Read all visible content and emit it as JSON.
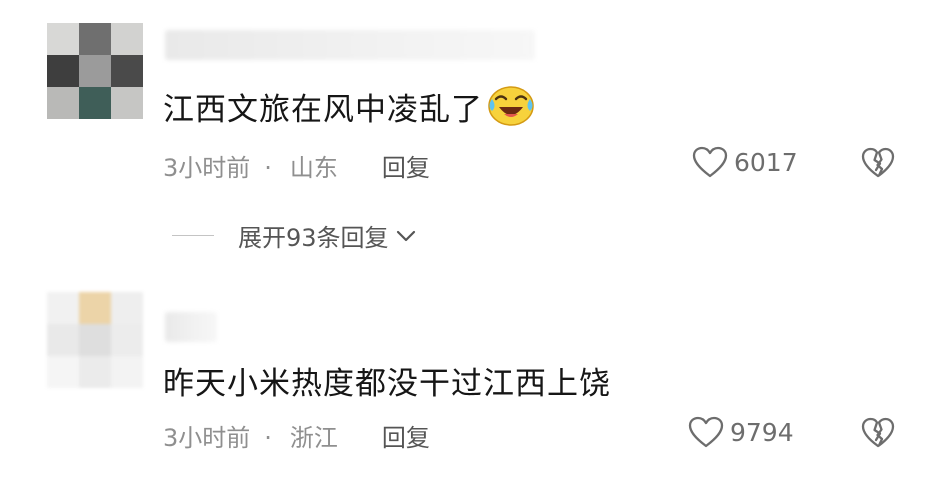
{
  "comments": [
    {
      "text": "江西文旅在风中凌乱了",
      "emoji": "laughing-crying-emoji",
      "time": "3小时前",
      "separator": "·",
      "location": "山东",
      "reply_label": "回复",
      "likes": "6017",
      "expand_label": "展开93条回复"
    },
    {
      "text": "昨天小米热度都没干过江西上饶",
      "time": "3小时前",
      "separator": "·",
      "location": "浙江",
      "reply_label": "回复",
      "likes": "9794"
    }
  ],
  "icons": {
    "like": "heart-outline-icon",
    "dislike": "broken-heart-icon",
    "expand": "chevron-down-icon"
  },
  "colors": {
    "text": "#161616",
    "meta": "#8f8f8f",
    "reply": "#555555",
    "icon": "#6d6d6d"
  }
}
